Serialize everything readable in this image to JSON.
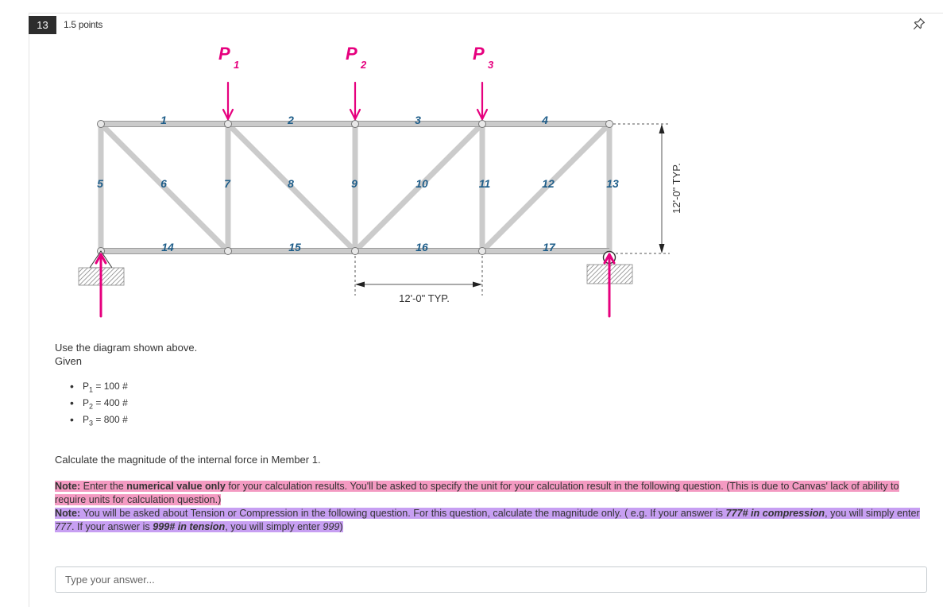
{
  "question": {
    "number": "13",
    "points": "1.5 points",
    "pin_icon": "pin-icon"
  },
  "diagram": {
    "load_labels": [
      {
        "letter": "P",
        "sub": "1"
      },
      {
        "letter": "P",
        "sub": "2"
      },
      {
        "letter": "P",
        "sub": "3"
      }
    ],
    "member_labels": [
      "1",
      "2",
      "3",
      "4",
      "5",
      "6",
      "7",
      "8",
      "9",
      "10",
      "11",
      "12",
      "13",
      "14",
      "15",
      "16",
      "17"
    ],
    "panel_dimension": "12'-0\" TYP.",
    "height_dimension": "12'-0\" TYP.",
    "colors": {
      "load": "#e6007e",
      "member_label": "#1f5e8a",
      "member": "#c9c9c9"
    }
  },
  "body": {
    "use_text": "Use the diagram shown above.",
    "given_label": "Given",
    "given": [
      {
        "var": "P",
        "sub": "1",
        "value": " = 100 #"
      },
      {
        "var": "P",
        "sub": "2",
        "value": " = 400 #"
      },
      {
        "var": "P",
        "sub": "3",
        "value": " = 800 #"
      }
    ],
    "question_text": "Calculate the magnitude of the internal force in Member 1.",
    "note1": {
      "label": "Note:",
      "t1": " Enter the ",
      "bold": "numerical value only",
      "t2": " for your calculation results. You'll be asked to specify the unit for your calculation result in the following question. (This is due to Canvas' lack of ability to require units for calculation question.)"
    },
    "note2": {
      "label": "Note:",
      "t1": " You will be asked about Tension or Compression in the following question. For this question, calculate the magnitude only. ( e.g. If your answer is ",
      "ex1": "777# in compression",
      "t2": ", you will simply enter ",
      "val1": "777",
      "t3": ". If your answer is ",
      "ex2": "999# in tension",
      "t4": ", you will simply enter ",
      "val2": "999",
      "t5": ")"
    }
  },
  "answer": {
    "placeholder": "Type your answer..."
  }
}
